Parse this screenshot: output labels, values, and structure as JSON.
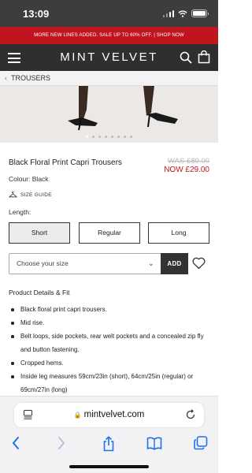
{
  "status": {
    "time": "13:09"
  },
  "promo": {
    "text": "MORE NEW LINES ADDED. SALE UP TO 60% OFF. | SHOP NOW"
  },
  "header": {
    "logo": "MINT VELVET"
  },
  "breadcrumb": {
    "label": "TROUSERS"
  },
  "gallery": {
    "dot_count": 8,
    "active_index": 0
  },
  "product": {
    "title": "Black Floral Print Capri Trousers",
    "was_price": "WAS £89.00",
    "now_price": "NOW £29.00",
    "colour": "Colour: Black",
    "size_guide": "SIZE GUIDE",
    "length_label": "Length:",
    "lengths": [
      "Short",
      "Regular",
      "Long"
    ],
    "selected_length": "Short",
    "size_placeholder": "Choose your size",
    "add_label": "ADD"
  },
  "details": {
    "title": "Product Details & Fit",
    "bullets": [
      "Black floral print capri trousers.",
      "Mid rise.",
      "Belt loops, side pockets, rear welt pockets and a concealed zip fly and button fastening.",
      "Cropped hems.",
      "Inside leg measures 59cm/23in (short), 64cm/25in (regular) or 69cm/27in (long)"
    ]
  },
  "browser": {
    "url": "mintvelvet.com"
  },
  "colors": {
    "promo": "#c0151f",
    "header": "#2f2f2f",
    "status": "#3d3d3d",
    "ios_blue": "#1a73e8"
  }
}
